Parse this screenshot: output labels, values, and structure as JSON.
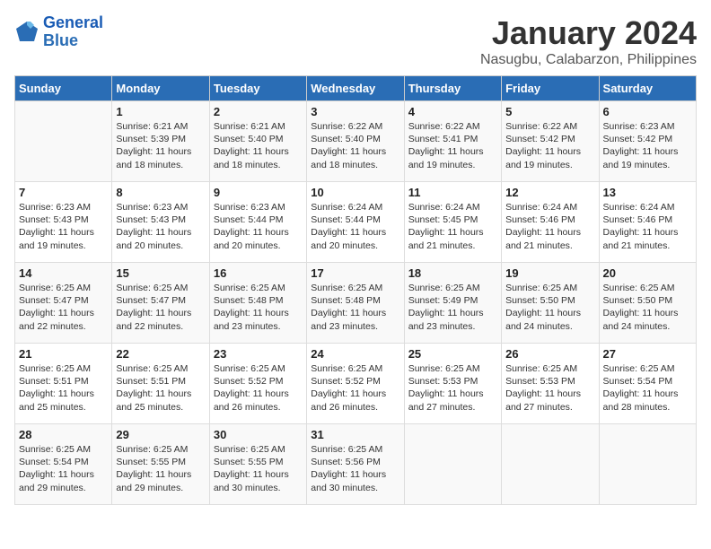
{
  "logo": {
    "line1": "General",
    "line2": "Blue"
  },
  "title": "January 2024",
  "subtitle": "Nasugbu, Calabarzon, Philippines",
  "days_header": [
    "Sunday",
    "Monday",
    "Tuesday",
    "Wednesday",
    "Thursday",
    "Friday",
    "Saturday"
  ],
  "weeks": [
    [
      {
        "num": "",
        "info": ""
      },
      {
        "num": "1",
        "info": "Sunrise: 6:21 AM\nSunset: 5:39 PM\nDaylight: 11 hours\nand 18 minutes."
      },
      {
        "num": "2",
        "info": "Sunrise: 6:21 AM\nSunset: 5:40 PM\nDaylight: 11 hours\nand 18 minutes."
      },
      {
        "num": "3",
        "info": "Sunrise: 6:22 AM\nSunset: 5:40 PM\nDaylight: 11 hours\nand 18 minutes."
      },
      {
        "num": "4",
        "info": "Sunrise: 6:22 AM\nSunset: 5:41 PM\nDaylight: 11 hours\nand 19 minutes."
      },
      {
        "num": "5",
        "info": "Sunrise: 6:22 AM\nSunset: 5:42 PM\nDaylight: 11 hours\nand 19 minutes."
      },
      {
        "num": "6",
        "info": "Sunrise: 6:23 AM\nSunset: 5:42 PM\nDaylight: 11 hours\nand 19 minutes."
      }
    ],
    [
      {
        "num": "7",
        "info": "Sunrise: 6:23 AM\nSunset: 5:43 PM\nDaylight: 11 hours\nand 19 minutes."
      },
      {
        "num": "8",
        "info": "Sunrise: 6:23 AM\nSunset: 5:43 PM\nDaylight: 11 hours\nand 20 minutes."
      },
      {
        "num": "9",
        "info": "Sunrise: 6:23 AM\nSunset: 5:44 PM\nDaylight: 11 hours\nand 20 minutes."
      },
      {
        "num": "10",
        "info": "Sunrise: 6:24 AM\nSunset: 5:44 PM\nDaylight: 11 hours\nand 20 minutes."
      },
      {
        "num": "11",
        "info": "Sunrise: 6:24 AM\nSunset: 5:45 PM\nDaylight: 11 hours\nand 21 minutes."
      },
      {
        "num": "12",
        "info": "Sunrise: 6:24 AM\nSunset: 5:46 PM\nDaylight: 11 hours\nand 21 minutes."
      },
      {
        "num": "13",
        "info": "Sunrise: 6:24 AM\nSunset: 5:46 PM\nDaylight: 11 hours\nand 21 minutes."
      }
    ],
    [
      {
        "num": "14",
        "info": "Sunrise: 6:25 AM\nSunset: 5:47 PM\nDaylight: 11 hours\nand 22 minutes."
      },
      {
        "num": "15",
        "info": "Sunrise: 6:25 AM\nSunset: 5:47 PM\nDaylight: 11 hours\nand 22 minutes."
      },
      {
        "num": "16",
        "info": "Sunrise: 6:25 AM\nSunset: 5:48 PM\nDaylight: 11 hours\nand 23 minutes."
      },
      {
        "num": "17",
        "info": "Sunrise: 6:25 AM\nSunset: 5:48 PM\nDaylight: 11 hours\nand 23 minutes."
      },
      {
        "num": "18",
        "info": "Sunrise: 6:25 AM\nSunset: 5:49 PM\nDaylight: 11 hours\nand 23 minutes."
      },
      {
        "num": "19",
        "info": "Sunrise: 6:25 AM\nSunset: 5:50 PM\nDaylight: 11 hours\nand 24 minutes."
      },
      {
        "num": "20",
        "info": "Sunrise: 6:25 AM\nSunset: 5:50 PM\nDaylight: 11 hours\nand 24 minutes."
      }
    ],
    [
      {
        "num": "21",
        "info": "Sunrise: 6:25 AM\nSunset: 5:51 PM\nDaylight: 11 hours\nand 25 minutes."
      },
      {
        "num": "22",
        "info": "Sunrise: 6:25 AM\nSunset: 5:51 PM\nDaylight: 11 hours\nand 25 minutes."
      },
      {
        "num": "23",
        "info": "Sunrise: 6:25 AM\nSunset: 5:52 PM\nDaylight: 11 hours\nand 26 minutes."
      },
      {
        "num": "24",
        "info": "Sunrise: 6:25 AM\nSunset: 5:52 PM\nDaylight: 11 hours\nand 26 minutes."
      },
      {
        "num": "25",
        "info": "Sunrise: 6:25 AM\nSunset: 5:53 PM\nDaylight: 11 hours\nand 27 minutes."
      },
      {
        "num": "26",
        "info": "Sunrise: 6:25 AM\nSunset: 5:53 PM\nDaylight: 11 hours\nand 27 minutes."
      },
      {
        "num": "27",
        "info": "Sunrise: 6:25 AM\nSunset: 5:54 PM\nDaylight: 11 hours\nand 28 minutes."
      }
    ],
    [
      {
        "num": "28",
        "info": "Sunrise: 6:25 AM\nSunset: 5:54 PM\nDaylight: 11 hours\nand 29 minutes."
      },
      {
        "num": "29",
        "info": "Sunrise: 6:25 AM\nSunset: 5:55 PM\nDaylight: 11 hours\nand 29 minutes."
      },
      {
        "num": "30",
        "info": "Sunrise: 6:25 AM\nSunset: 5:55 PM\nDaylight: 11 hours\nand 30 minutes."
      },
      {
        "num": "31",
        "info": "Sunrise: 6:25 AM\nSunset: 5:56 PM\nDaylight: 11 hours\nand 30 minutes."
      },
      {
        "num": "",
        "info": ""
      },
      {
        "num": "",
        "info": ""
      },
      {
        "num": "",
        "info": ""
      }
    ]
  ]
}
